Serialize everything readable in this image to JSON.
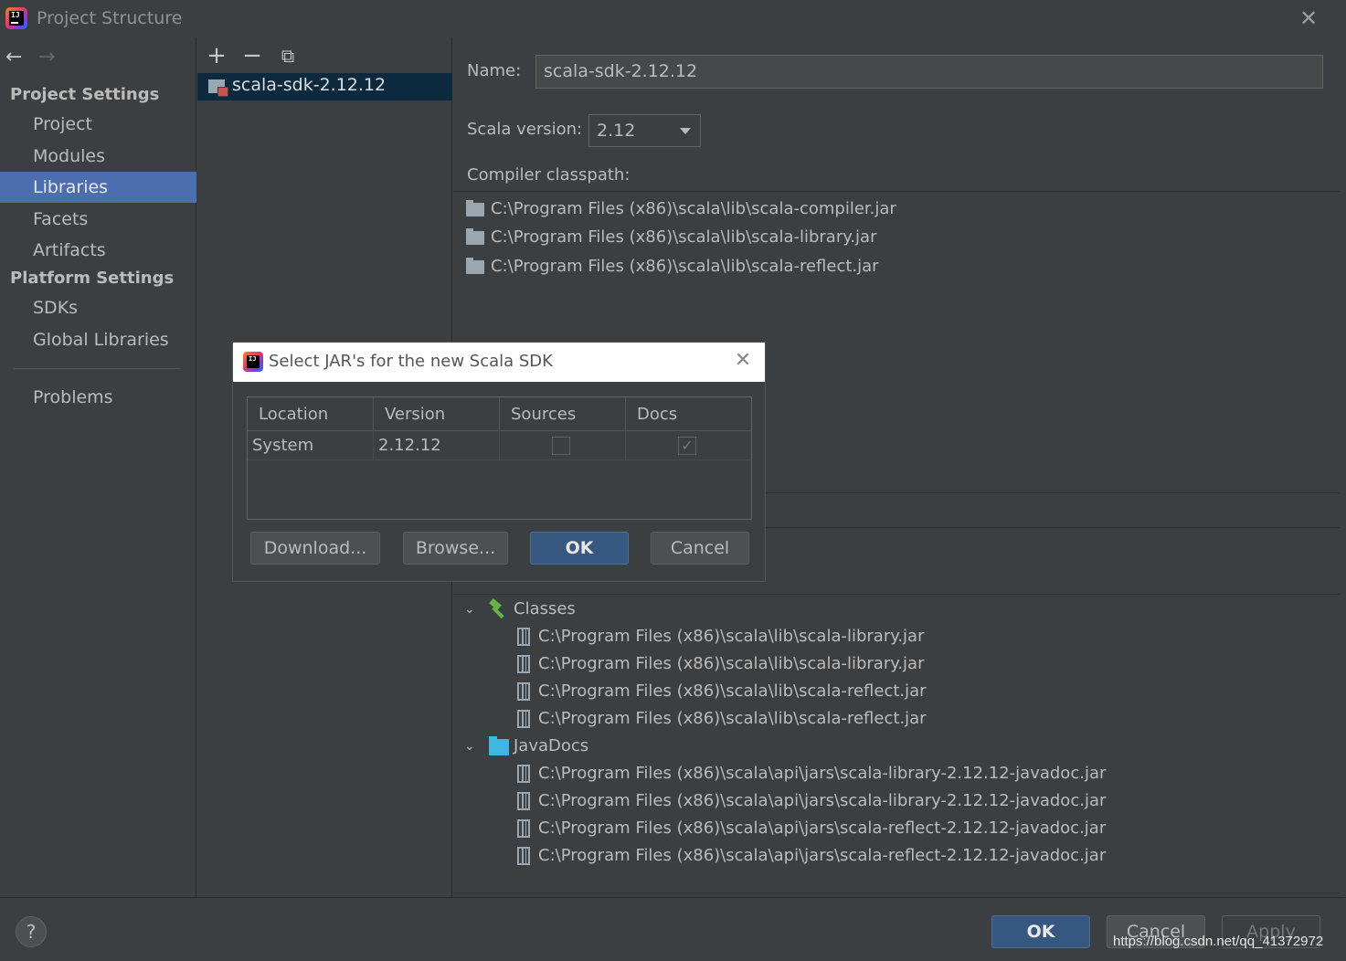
{
  "window": {
    "title": "Project Structure"
  },
  "sidebar": {
    "project_settings_header": "Project Settings",
    "platform_settings_header": "Platform Settings",
    "items": [
      {
        "label": "Project"
      },
      {
        "label": "Modules"
      },
      {
        "label": "Libraries",
        "selected": true
      },
      {
        "label": "Facets"
      },
      {
        "label": "Artifacts"
      },
      {
        "label": "SDKs"
      },
      {
        "label": "Global Libraries"
      },
      {
        "label": "Problems"
      }
    ]
  },
  "libraries": {
    "items": [
      {
        "label": "scala-sdk-2.12.12"
      }
    ]
  },
  "detail": {
    "name_label": "Name:",
    "name_value": "scala-sdk-2.12.12",
    "scala_version_label": "Scala version:",
    "scala_version_value": "2.12",
    "compiler_classpath_label": "Compiler classpath:",
    "classpath": [
      "C:\\Program Files (x86)\\scala\\lib\\scala-compiler.jar",
      "C:\\Program Files (x86)\\scala\\lib\\scala-library.jar",
      "C:\\Program Files (x86)\\scala\\lib\\scala-reflect.jar"
    ],
    "tree": {
      "classes_label": "Classes",
      "classes": [
        "C:\\Program Files (x86)\\scala\\lib\\scala-library.jar",
        "C:\\Program Files (x86)\\scala\\lib\\scala-library.jar",
        "C:\\Program Files (x86)\\scala\\lib\\scala-reflect.jar",
        "C:\\Program Files (x86)\\scala\\lib\\scala-reflect.jar"
      ],
      "javadocs_label": "JavaDocs",
      "javadocs": [
        "C:\\Program Files (x86)\\scala\\api\\jars\\scala-library-2.12.12-javadoc.jar",
        "C:\\Program Files (x86)\\scala\\api\\jars\\scala-library-2.12.12-javadoc.jar",
        "C:\\Program Files (x86)\\scala\\api\\jars\\scala-reflect-2.12.12-javadoc.jar",
        "C:\\Program Files (x86)\\scala\\api\\jars\\scala-reflect-2.12.12-javadoc.jar"
      ]
    }
  },
  "footer": {
    "help_label": "?",
    "ok_label": "OK",
    "cancel_label": "Cancel",
    "apply_label": "Apply",
    "watermark": "https://blog.csdn.net/qq_41372972"
  },
  "dialog": {
    "title": "Select JAR's for the new Scala SDK",
    "columns": [
      "Location",
      "Version",
      "Sources",
      "Docs"
    ],
    "rows": [
      {
        "location": "System",
        "version": "2.12.12",
        "sources": false,
        "docs": true
      }
    ],
    "download_label": "Download...",
    "browse_label": "Browse...",
    "ok_label": "OK",
    "cancel_label": "Cancel"
  },
  "colors": {
    "background": "#3c3f41",
    "selection": "#4b6eaf",
    "tree_selection": "#0d293e",
    "primary_button": "#365880",
    "text": "#bbbbbb"
  }
}
